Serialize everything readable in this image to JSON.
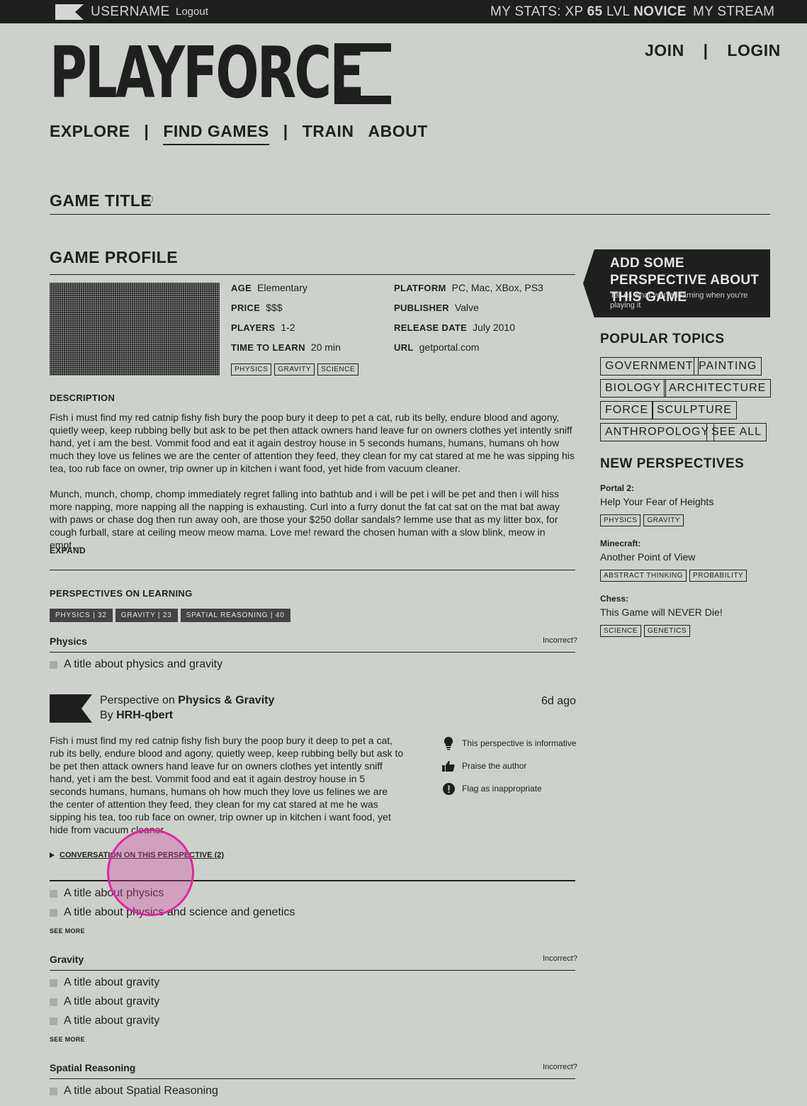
{
  "topbar": {
    "username": "USERNAME",
    "logout": "Logout",
    "stats_prefix": "MY STATS: XP",
    "xp": "65",
    "lvl_label": "LVL",
    "level": "NOVICE",
    "stream": "MY STREAM"
  },
  "brand": {
    "name": "PLAYFORCE"
  },
  "auth": {
    "join": "JOIN",
    "sep": "|",
    "login": "LOGIN"
  },
  "nav": {
    "explore": "EXPLORE",
    "sep": "|",
    "find_games": "FIND GAMES",
    "train": "TRAIN",
    "about": "ABOUT"
  },
  "game": {
    "title": "GAME TITLE",
    "heart": "♡",
    "profile_heading": "GAME PROFILE",
    "fields": {
      "age_k": "AGE",
      "age_v": "Elementary",
      "price_k": "PRICE",
      "price_v": "$$$",
      "players_k": "PLAYERS",
      "players_v": "1-2",
      "ttl_k": "TIME TO LEARN",
      "ttl_v": "20 min",
      "platform_k": "PLATFORM",
      "platform_v": "PC, Mac, XBox, PS3",
      "publisher_k": "PUBLISHER",
      "publisher_v": "Valve",
      "release_k": "RELEASE DATE",
      "release_v": "July 2010",
      "url_k": "URL",
      "url_v": "getportal.com"
    },
    "tags": [
      "PHYSICS",
      "GRAVITY",
      "SCIENCE"
    ],
    "description_heading": "DESCRIPTION",
    "desc_p1": "Fish i must find my red catnip fishy fish bury the poop bury it deep to pet a cat, rub its belly, endure blood and agony, quietly weep, keep rubbing belly but ask to be pet then attack owners hand leave fur on owners clothes yet intently sniff hand, yet i am the best. Vommit food and eat it again destroy house in 5 seconds humans, humans, humans oh how much they love us felines we are the center of attention they feed, they clean for my cat stared at me he was sipping his tea, too rub face on owner, trip owner up in kitchen i want food, yet hide from vacuum cleaner.",
    "desc_p2": "Munch, munch, chomp, chomp immediately regret falling into bathtub and i will be pet i will be pet and then i will hiss more napping, more napping all the napping is exhausting. Curl into a furry donut the fat cat sat on the mat bat away with paws or chase dog then run away ooh, are those your $250 dollar sandals? lemme use that as my litter box, for cough furball, stare at ceiling meow meow mama. Love me! reward the chosen human with a slow blink, meow in empt…",
    "expand": "EXPAND"
  },
  "perspectives": {
    "heading": "PERSPECTIVES ON LEARNING",
    "tags": [
      "PHYSICS | 32",
      "GRAVITY | 23",
      "SPATIAL REASONING | 40"
    ],
    "incorrect": "Incorrect?",
    "see_more": "SEE MORE",
    "physics": {
      "title": "Physics",
      "item1": "A title about physics and gravity",
      "card": {
        "prefix": "Perspective on",
        "topic": "Physics & Gravity",
        "by": "By",
        "author": "HRH-qbert",
        "time": "6d ago",
        "body": "Fish i must find my red catnip fishy fish bury the poop bury it deep to pet a cat, rub its belly, endure blood and agony, quietly weep, keep rubbing belly but ask to be pet then attack owners hand leave fur on owners clothes yet intently sniff hand, yet i am the best. Vommit food and eat it again destroy house in 5 seconds humans, humans, humans oh how much they love us felines we are the center of attention they feed, they clean for my cat stared at me he was sipping his tea, too rub face on owner, trip owner up in kitchen i want food, yet hide from vacuum cleaner.",
        "action_informative": "This perspective is informative",
        "action_praise": "Praise the author",
        "action_flag": "Flag as inappropriate",
        "conversation": "CONVERSATION ON THIS PERSPECTIVE (2)"
      },
      "item2": "A title about physics",
      "item3": "A title about physics and science and genetics"
    },
    "gravity": {
      "title": "Gravity",
      "items": [
        "A title about gravity",
        "A title about gravity",
        "A title about gravity"
      ]
    },
    "spatial": {
      "title": "Spatial Reasoning",
      "item1": "A title about Spatial Reasoning"
    }
  },
  "sidebar": {
    "cta_title": "ADD SOME PERSPECTIVE ABOUT THIS GAME",
    "cta_sub": "Tell us what you're learning when you're playing it",
    "popular_heading": "POPULAR TOPICS",
    "topics": [
      "GOVERNMENT",
      "PAINTING",
      "BIOLOGY",
      "ARCHITECTURE",
      "FORCE",
      "SCULPTURE",
      "ANTHROPOLOGY",
      "SEE ALL"
    ],
    "new_heading": "NEW PERSPECTIVES",
    "new_items": [
      {
        "game": "Portal 2:",
        "title": "Help Your Fear of Heights",
        "tags": [
          "PHYSICS",
          "GRAVITY"
        ]
      },
      {
        "game": "Minecraft:",
        "title": "Another Point of View",
        "tags": [
          "ABSTRACT THINKING",
          "PROBABILITY"
        ]
      },
      {
        "game": "Chess:",
        "title": "This Game will NEVER Die!",
        "tags": [
          "SCIENCE",
          "GENETICS"
        ]
      }
    ]
  }
}
